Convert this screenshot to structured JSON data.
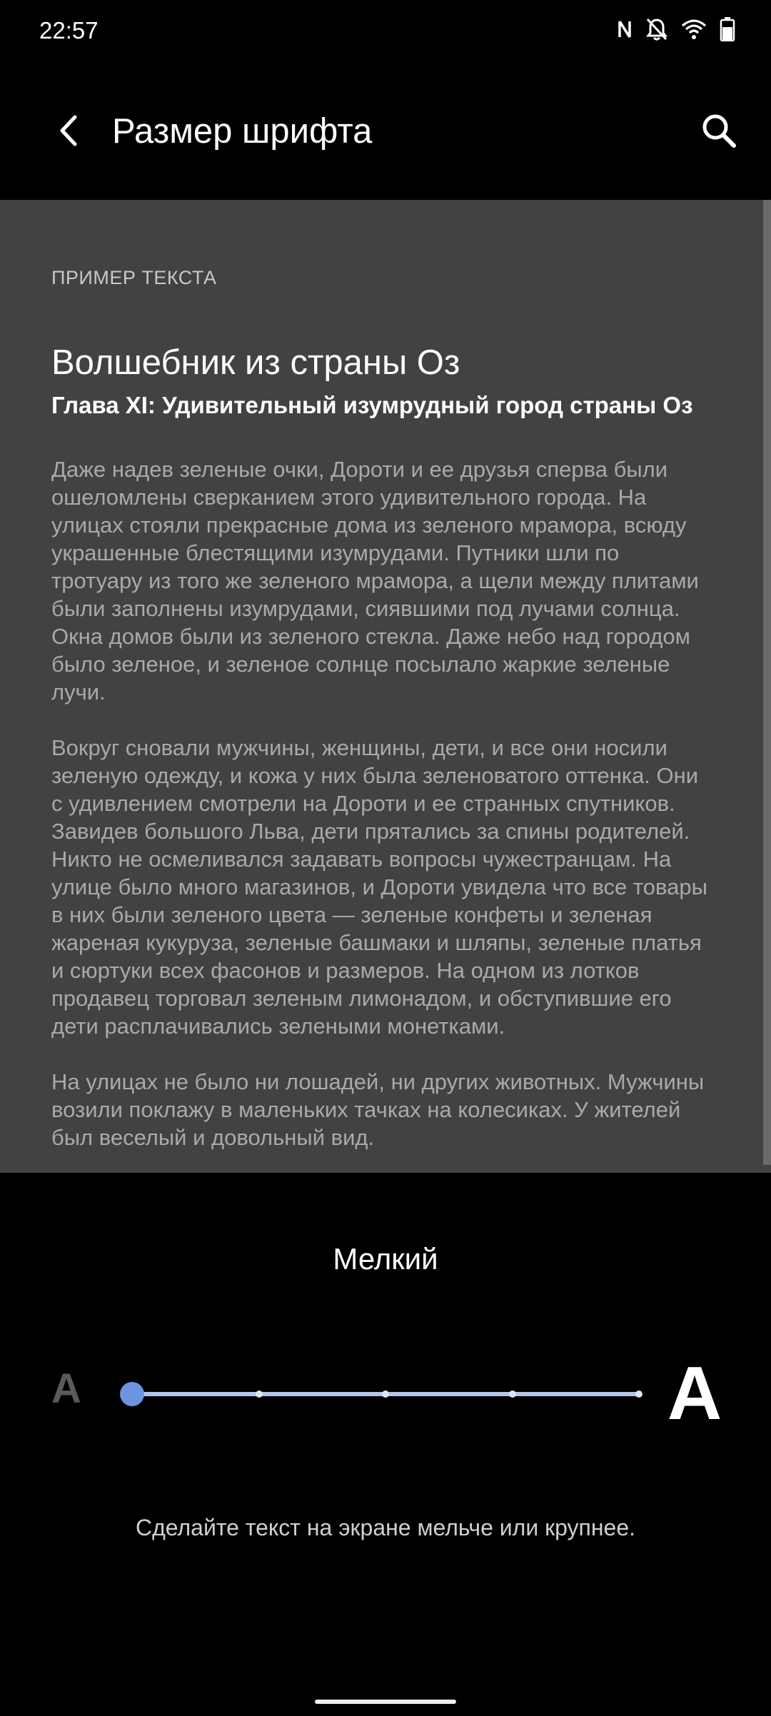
{
  "status_bar": {
    "time": "22:57",
    "icons": [
      "nfc-icon",
      "notifications-off-icon",
      "wifi-icon",
      "battery-icon"
    ]
  },
  "app_bar": {
    "title": "Размер шрифта",
    "back_icon": "back-arrow-icon",
    "search_icon": "search-icon"
  },
  "preview": {
    "label": "ПРИМЕР ТЕКСТА",
    "book_title": "Волшебник из страны Оз",
    "chapter_title": "Глава XI: Удивительный изумрудный город страны Оз",
    "paragraphs": [
      "Даже надев зеленые очки, Дороти и ее друзья сперва были ошеломлены сверканием этого удивительного города. На улицах стояли прекрасные дома из зеленого мрамора, всюду украшенные блестящими изумрудами. Путники шли по тротуару из того же зеленого мрамора, а щели между плитами были заполнены изумрудами, сиявшими под лучами солнца. Окна домов были из зеленого стекла. Даже небо над городом было зеленое, и зеленое солнце посылало жаркие зеленые лучи.",
      "Вокруг сновали мужчины, женщины, дети, и все они носили зеленую одежду, и кожа у них была зеленоватого оттенка. Они с удивлением смотрели на Дороти и ее странных спутников. Завидев большого Льва, дети прятались за спины родителей. Никто не осмеливался задавать вопросы чужестранцам. На улице было много магазинов, и Дороти увидела что все товары в них были зеленого цвета — зеленые конфеты и зеленая жареная кукуруза, зеленые башмаки и шляпы, зеленые платья и сюртуки всех фасонов и размеров. На одном из лотков продавец торговал зеленым лимонадом, и обступившие его дети расплачивались зелеными монетками.",
      "На улицах не было ни лошадей, ни других животных. Мужчины возили поклажу в маленьких тачках на колесиках. У жителей был веселый и довольный вид."
    ]
  },
  "font_size": {
    "current_label": "Мелкий",
    "selected_step": 1,
    "step_count": 5,
    "small_icon": "text-size-small-icon",
    "large_icon": "text-size-large-icon",
    "helper_text": "Сделайте текст на экране мельче или крупнее."
  },
  "colors": {
    "accent": "#6e93e0",
    "track": "#b5c4ea",
    "preview_background": "#424242"
  }
}
